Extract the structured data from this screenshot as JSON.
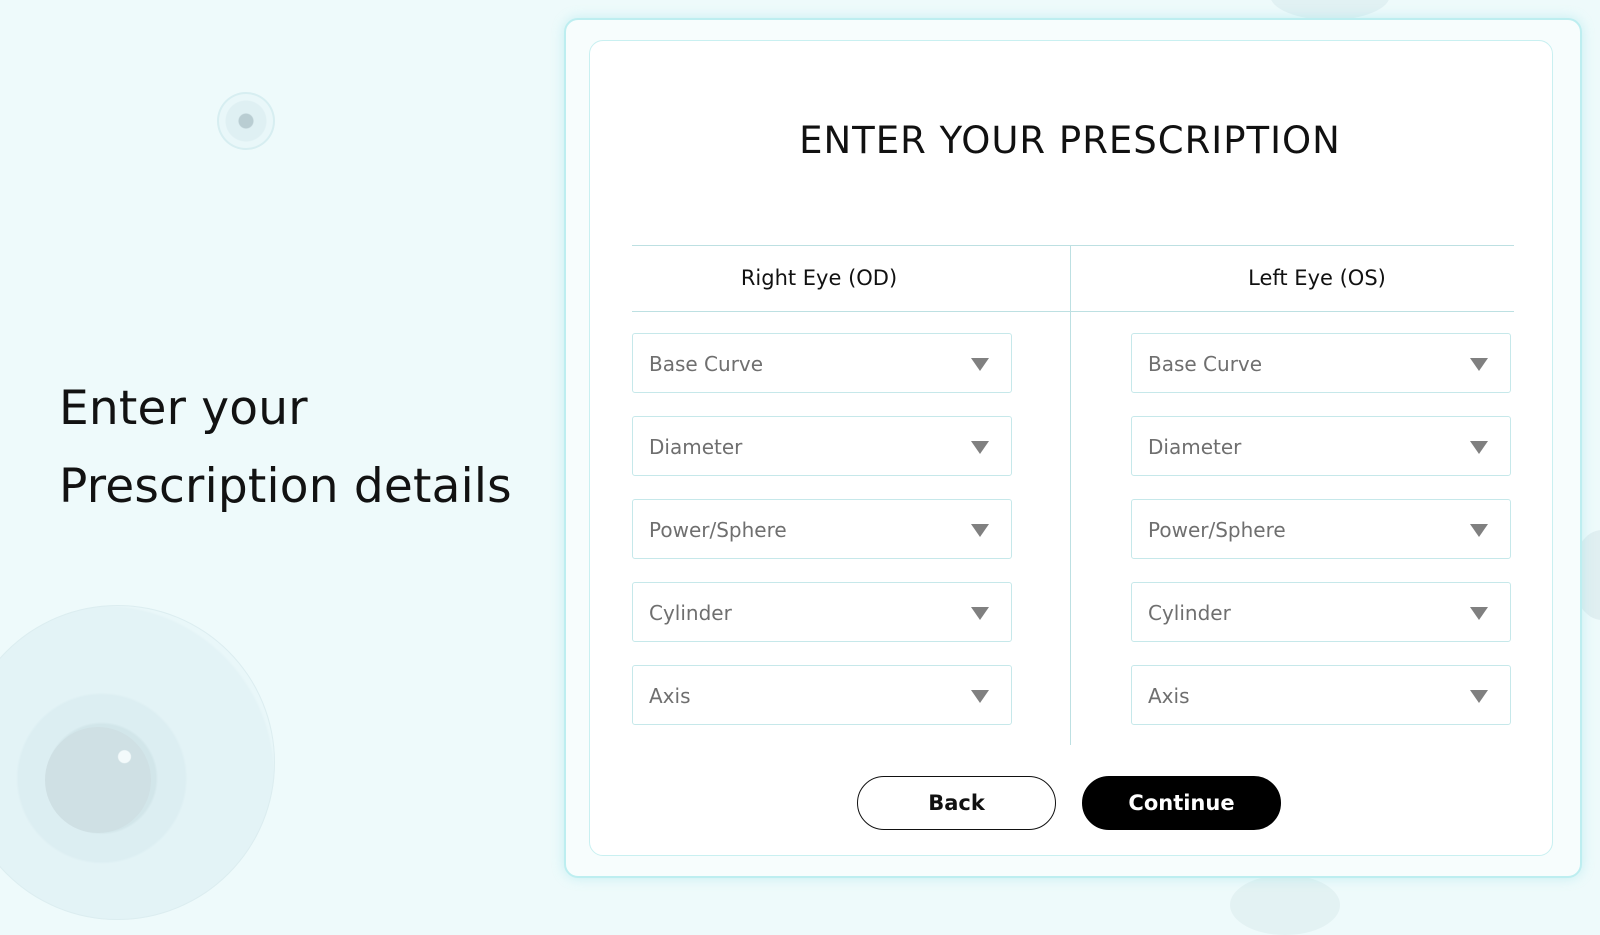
{
  "hero": {
    "line1": "Enter your",
    "line2": "Prescription details"
  },
  "form": {
    "title": "ENTER YOUR PRESCRIPTION",
    "right_eye": {
      "heading": "Right Eye (OD)",
      "fields": [
        "Base Curve",
        "Diameter",
        "Power/Sphere",
        "Cylinder",
        "Axis"
      ]
    },
    "left_eye": {
      "heading": "Left Eye (OS)",
      "fields": [
        "Base Curve",
        "Diameter",
        "Power/Sphere",
        "Cylinder",
        "Axis"
      ]
    },
    "buttons": {
      "back": "Back",
      "continue": "Continue"
    }
  },
  "colors": {
    "background": "#eefafb",
    "card_border": "#bdeef0",
    "primary_button": "#000000"
  },
  "icons": {
    "dropdown": "caret-down-icon"
  }
}
